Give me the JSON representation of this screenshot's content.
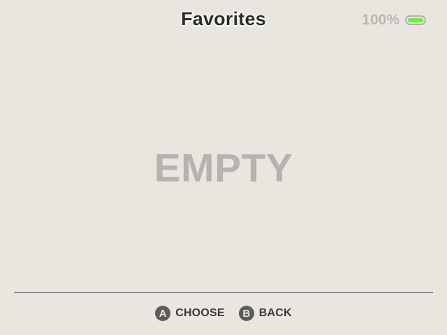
{
  "header": {
    "title": "Favorites"
  },
  "status": {
    "battery_text": "100%",
    "battery_level": 1.0,
    "battery_fill_color": "#6bef3a"
  },
  "main": {
    "empty_text": "EMPTY"
  },
  "footer": {
    "hints": [
      {
        "button": "A",
        "label": "CHOOSE"
      },
      {
        "button": "B",
        "label": "BACK"
      }
    ]
  }
}
